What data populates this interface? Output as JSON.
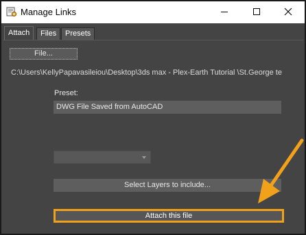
{
  "window": {
    "title": "Manage Links",
    "icon": "manage-links-app-icon",
    "controls": [
      "minimize-icon",
      "maximize-icon",
      "close-icon"
    ]
  },
  "tabs": [
    {
      "label": "Attach",
      "active": true
    },
    {
      "label": "Files",
      "active": false
    },
    {
      "label": "Presets",
      "active": false
    }
  ],
  "attach": {
    "file_button": "File...",
    "file_path": "C:\\Users\\KellyPapavasileiou\\Desktop\\3ds max - Plex-Earth Tutorial   \\St.George te",
    "preset_label": "Preset:",
    "preset_value": "DWG File Saved from AutoCAD",
    "dropdown_value": "",
    "select_layers_button": "Select Layers to include...",
    "attach_button": "Attach this file"
  },
  "colors": {
    "background": "#444444",
    "highlight": "#f2a21a",
    "text": "#e8e8e8"
  },
  "annotation": {
    "type": "arrow-icon",
    "color": "#f2a21a"
  }
}
